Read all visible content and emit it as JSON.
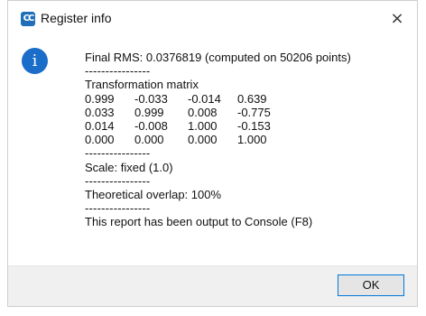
{
  "dialog": {
    "title": "Register info",
    "app_icon": "cloudcompare-icon",
    "close_glyph": "×",
    "info_icon_glyph": "i",
    "lines": {
      "rms": "Final RMS: 0.0376819 (computed on 50206 points)",
      "sep1": "----------------",
      "matrix_title": "Transformation matrix",
      "sep2": "----------------",
      "scale": "Scale: fixed (1.0)",
      "sep3": "----------------",
      "overlap": "Theoretical overlap: 100%",
      "sep4": "----------------",
      "console": "This report has been output to Console (F8)"
    },
    "matrix": [
      [
        "0.999",
        "-0.033",
        "-0.014",
        "0.639"
      ],
      [
        "0.033",
        "0.999",
        "0.008",
        "-0.775"
      ],
      [
        "0.014",
        "-0.008",
        "1.000",
        "-0.153"
      ],
      [
        "0.000",
        "0.000",
        "0.000",
        "1.000"
      ]
    ],
    "ok_label": "OK",
    "colors": {
      "accent": "#0078d7",
      "info_icon": "#1a6dc8",
      "footer_bg": "#f0f0f0"
    }
  }
}
